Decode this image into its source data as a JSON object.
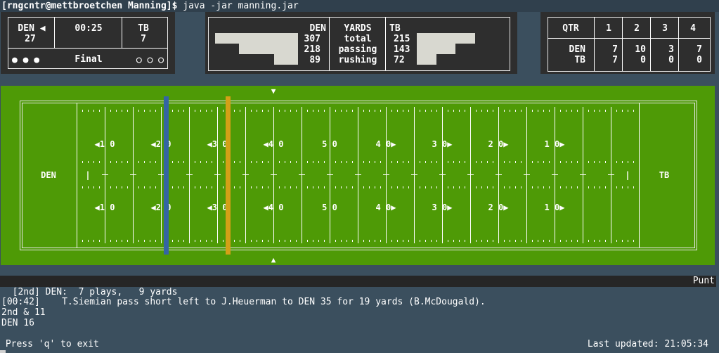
{
  "terminal": {
    "prompt_user": "[rngcntr@mettbroetchen Manning]$ ",
    "command": "java -jar manning.jar"
  },
  "scoreboard": {
    "away_team": "DEN ◀",
    "away_score": "27",
    "clock": "00:25",
    "home_team": "TB",
    "home_score": "7",
    "away_timeouts": "● ● ●",
    "status": "Final",
    "home_timeouts": "○ ○ ○"
  },
  "yards": {
    "header_left": "DEN",
    "header_mid": "YARDS",
    "header_right": "TB",
    "rows": [
      {
        "left": "307",
        "label": "total",
        "right": "215"
      },
      {
        "left": "218",
        "label": "passing",
        "right": "143"
      },
      {
        "left": "89",
        "label": "rushing",
        "right": "72"
      }
    ],
    "bar_max": 307
  },
  "quarters": {
    "header": [
      "QTR",
      "1",
      "2",
      "3",
      "4"
    ],
    "teams": "DEN\nTB",
    "den": [
      "7",
      "10",
      "3",
      "7"
    ],
    "tb": [
      "7",
      "0",
      "0",
      "0"
    ]
  },
  "field": {
    "left_endzone": "DEN",
    "right_endzone": "TB",
    "left_pylon": "|",
    "right_pylon": "|",
    "top_marker": "▼",
    "bottom_marker": "▲",
    "yard_labels": [
      "◀1 0",
      "◀2 0",
      "◀3 0",
      "◀4 0",
      "5 0",
      "4 0▶",
      "3 0▶",
      "2 0▶",
      "1 0▶"
    ],
    "line_of_scrimmage_color": "#3465a4",
    "first_down_color": "#d4a017",
    "field_color": "#4e9a06"
  },
  "drive": {
    "summary": "[2nd] DEN:  7 plays,   9 yards",
    "result": "Punt"
  },
  "log": {
    "play": "[00:42]    T.Siemian pass short left to J.Heuerman to DEN 35 for 19 yards (B.McDougald).",
    "down": "2nd & 11",
    "spot": "DEN 16"
  },
  "footer": {
    "exit_hint": " Press 'q' to exit",
    "updated": "Last updated: 21:05:34"
  }
}
